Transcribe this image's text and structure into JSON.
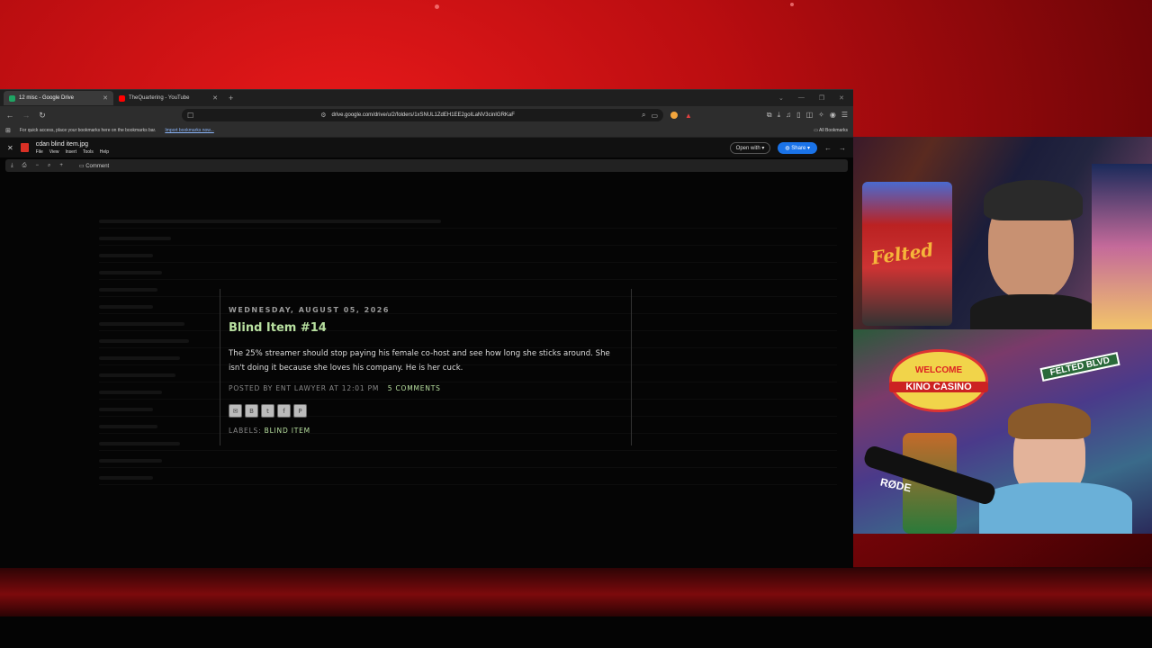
{
  "browser": {
    "tabs": [
      {
        "label": "12 misc - Google Drive",
        "active": true,
        "favicon_color": "#1fa463"
      },
      {
        "label": "TheQuartering - YouTube",
        "active": false,
        "favicon_color": "#ff0000"
      }
    ],
    "new_tab_symbol": "+",
    "url": "drive.google.com/drive/u/2/folders/1xSNUL1ZdEH1EE2goILaNV3cinIGRKaF",
    "bookmarks_prompt": "For quick access, place your bookmarks here on the bookmarks bar.",
    "bookmarks_link": "Import bookmarks now...",
    "all_bookmarks": "All Bookmarks"
  },
  "viewer": {
    "file_name": "cdan blind item.jpg",
    "menu": [
      "File",
      "View",
      "Insert",
      "Tools",
      "Help"
    ],
    "open_with": "Open with",
    "share": "Share",
    "comment": "Comment"
  },
  "post": {
    "date": "WEDNESDAY, AUGUST 05, 2026",
    "title": "Blind Item #14",
    "body": "The 25% streamer should stop paying his female co-host and see how long she sticks around. She isn't doing it because she loves his company. He is her cuck.",
    "posted_by_prefix": "POSTED BY ENT LAWYER AT 12:01 PM",
    "comments": "5 COMMENTS",
    "labels_prefix": "LABELS:",
    "label": "BLIND ITEM"
  },
  "webcams": {
    "top_sign": "Felted",
    "bottom_sign_welcome": "WELCOME",
    "bottom_sign_casino": "KINO CASINO",
    "bottom_sign_street": "FELTED BLVD",
    "mic_brand": "RØDE"
  },
  "colors": {
    "accent_red": "#c4090c",
    "post_title": "#b8e0a0",
    "share_blue": "#1a73e8"
  }
}
